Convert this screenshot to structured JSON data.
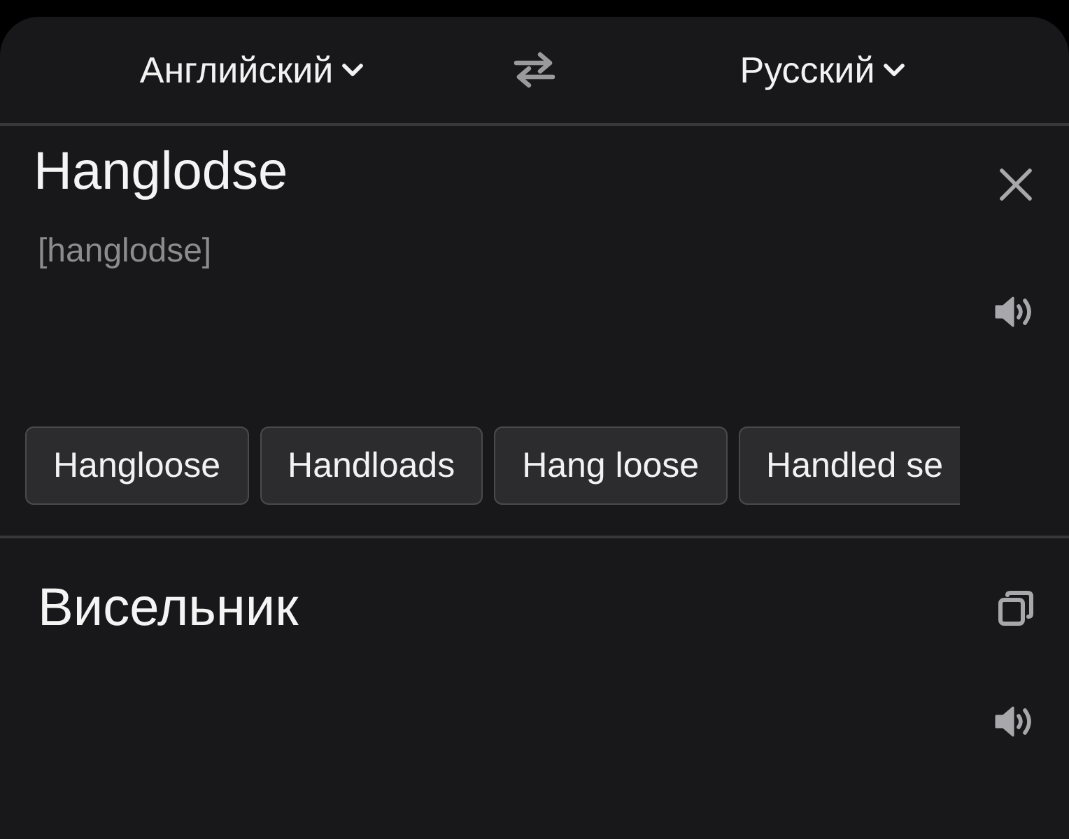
{
  "header": {
    "source_language": "Английский",
    "target_language": "Русский"
  },
  "source": {
    "text": "Hanglodse",
    "transcription": "[hanglodse]"
  },
  "suggestions": [
    "Hangloose",
    "Handloads",
    "Hang loose",
    "Handled se"
  ],
  "translation": {
    "text": "Висельник"
  }
}
